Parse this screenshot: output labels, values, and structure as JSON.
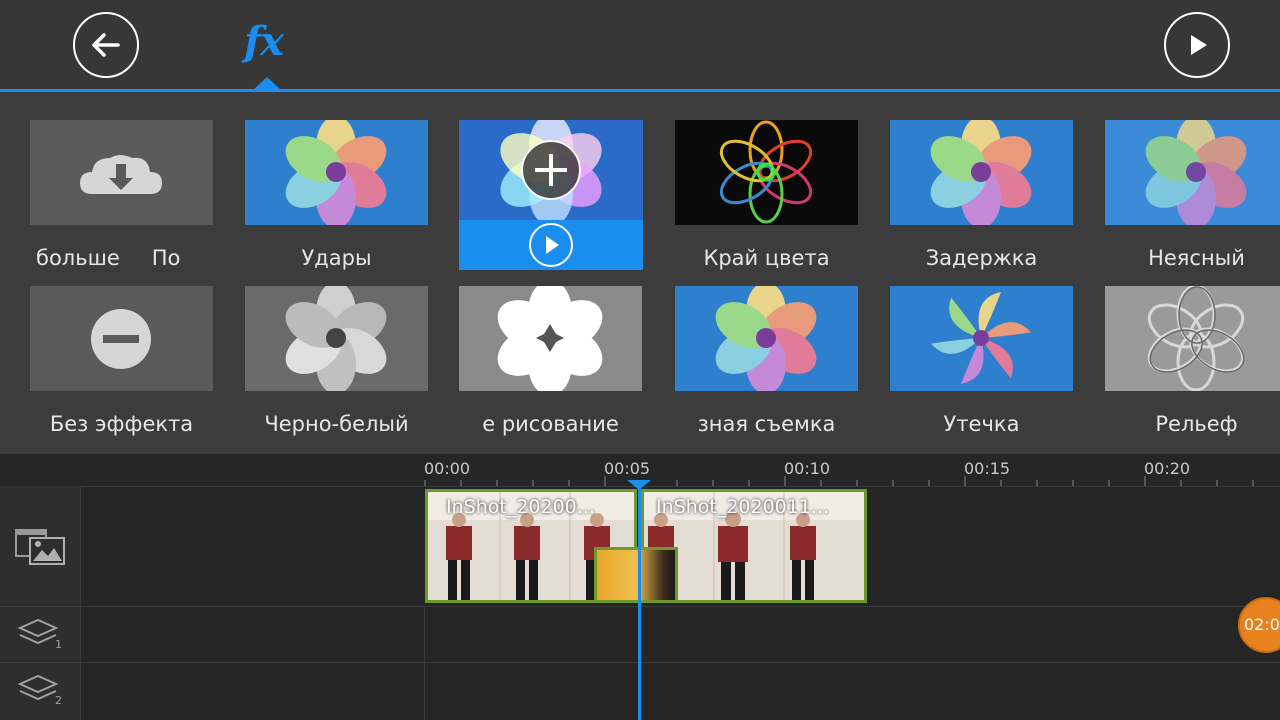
{
  "header": {
    "back_label": "Back",
    "fx_label": "fx",
    "play_label": "Play"
  },
  "effects": {
    "row1": [
      {
        "label": "больше",
        "label2": "По",
        "kind": "download"
      },
      {
        "label": "Удары",
        "kind": "pinwheel"
      },
      {
        "label": "",
        "kind": "selected"
      },
      {
        "label": "Край цвета",
        "kind": "neon"
      },
      {
        "label": "Задержка",
        "kind": "pinwheel"
      },
      {
        "label": "Неясный",
        "kind": "pinwheel"
      }
    ],
    "row2": [
      {
        "label": "Без эффекта",
        "kind": "none"
      },
      {
        "label": "Черно-белый",
        "kind": "bw"
      },
      {
        "label": "е рисование",
        "kind": "sketch"
      },
      {
        "label": "зная съемка",
        "kind": "pinwheel"
      },
      {
        "label": "Утечка",
        "kind": "swirl"
      },
      {
        "label": "Рельеф",
        "kind": "emboss"
      }
    ]
  },
  "timeline": {
    "ticks": [
      "00:00",
      "00:05",
      "00:10",
      "00:15",
      "00:20"
    ],
    "clips": [
      {
        "title": "InShot_20200..."
      },
      {
        "title": "InShot_2020011..."
      }
    ],
    "layer1_index": "1",
    "layer2_index": "2",
    "end_badge": "02:0"
  },
  "colors": {
    "accent": "#1a8ef0",
    "clip_border": "#6c9a2e",
    "badge": "#e8821e"
  }
}
